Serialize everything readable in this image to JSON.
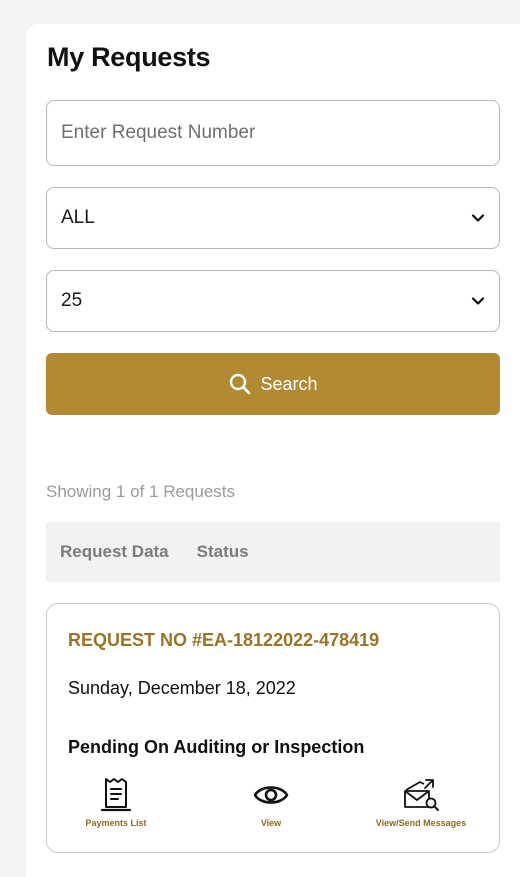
{
  "page": {
    "title": "My Requests"
  },
  "search": {
    "request_number_placeholder": "Enter Request Number",
    "request_number_value": "",
    "status_filter_value": "ALL",
    "page_size_value": "25",
    "button_label": "Search"
  },
  "results": {
    "summary": "Showing 1 of 1 Requests",
    "columns": [
      "Request Data",
      "Status"
    ],
    "requests": [
      {
        "number": "REQUEST NO #EA-18122022-478419",
        "date": "Sunday, December 18, 2022",
        "status": "Pending On Auditing or Inspection",
        "actions": [
          {
            "label": "Payments List",
            "icon": "receipt-icon"
          },
          {
            "label": "View",
            "icon": "eye-icon"
          },
          {
            "label": "View/Send Messages",
            "icon": "message-search-icon"
          }
        ]
      }
    ]
  },
  "colors": {
    "accent": "#b38a34",
    "accent_text": "#9a7328"
  }
}
